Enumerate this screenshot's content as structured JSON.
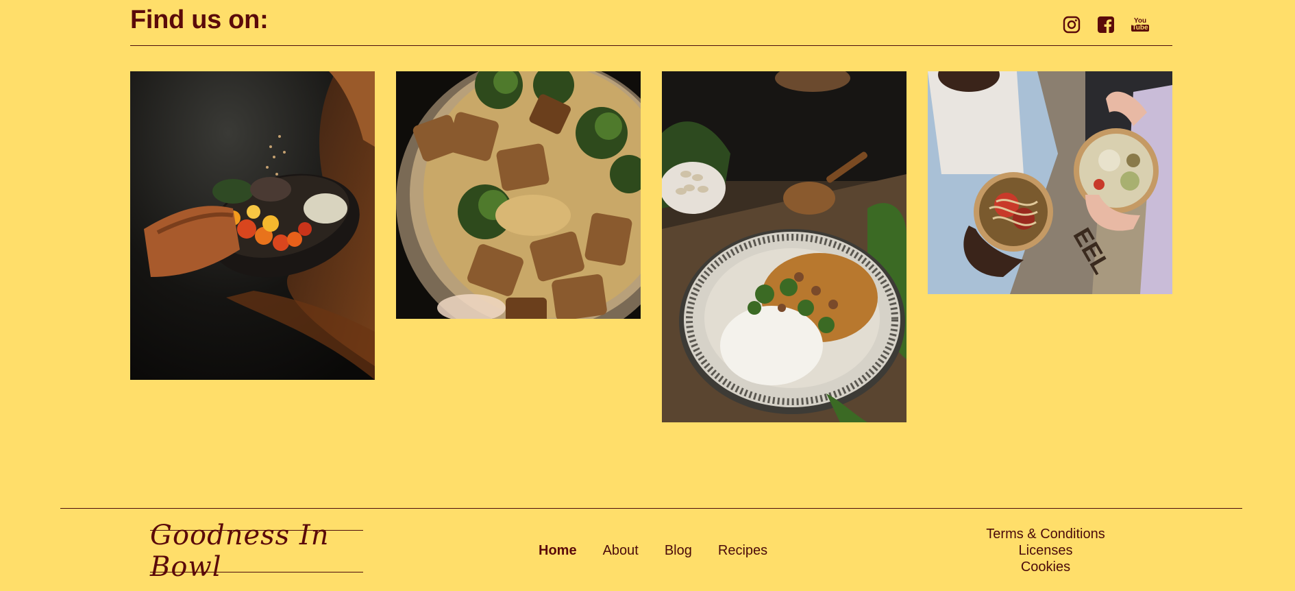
{
  "header": {
    "title": "Find us on:",
    "socials": [
      {
        "name": "instagram-icon"
      },
      {
        "name": "facebook-icon"
      },
      {
        "name": "youtube-icon",
        "text_top": "You",
        "text_bottom": "Tube"
      }
    ]
  },
  "gallery": {
    "photos": [
      {
        "name": "photo-bowl-toppings",
        "alt": ""
      },
      {
        "name": "photo-tofu-curry",
        "alt": ""
      },
      {
        "name": "photo-rice-dal",
        "alt": ""
      },
      {
        "name": "photo-two-salad-bowls",
        "alt": ""
      }
    ]
  },
  "footer": {
    "logo_text": "Goodness In Bowl",
    "nav": [
      {
        "label": "Home",
        "active": true
      },
      {
        "label": "About"
      },
      {
        "label": "Blog"
      },
      {
        "label": "Recipes"
      }
    ],
    "legal": [
      "Terms & Conditions",
      "Licenses",
      "Cookies"
    ]
  },
  "colors": {
    "background": "#FFDE6A",
    "text_dark_red": "#5A0A0A",
    "line": "#4A0A0A"
  }
}
